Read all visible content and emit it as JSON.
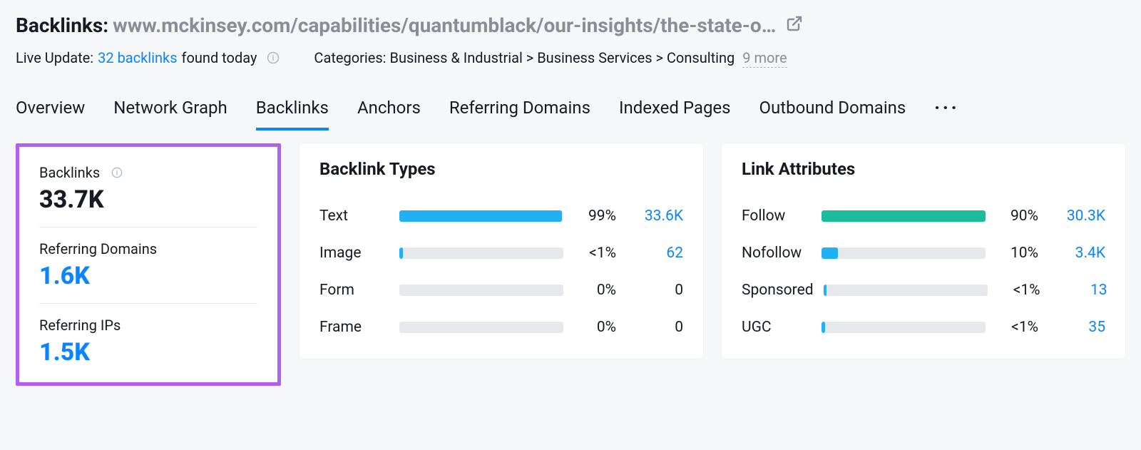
{
  "header": {
    "title_prefix": "Backlinks:",
    "domain_text": "www.mckinsey.com/capabilities/quantumblack/our-insights/the-state-o…"
  },
  "subheader": {
    "live_update_prefix": "Live Update:",
    "backlinks_count_text": "32 backlinks",
    "found_today": "found today",
    "categories_text": "Categories: Business & Industrial > Business Services > Consulting",
    "more_text": "9 more"
  },
  "tabs": {
    "items": [
      {
        "label": "Overview",
        "active": false
      },
      {
        "label": "Network Graph",
        "active": false
      },
      {
        "label": "Backlinks",
        "active": true
      },
      {
        "label": "Anchors",
        "active": false
      },
      {
        "label": "Referring Domains",
        "active": false
      },
      {
        "label": "Indexed Pages",
        "active": false
      },
      {
        "label": "Outbound Domains",
        "active": false
      }
    ]
  },
  "summary": {
    "backlinks_label": "Backlinks",
    "backlinks_value": "33.7K",
    "referring_domains_label": "Referring Domains",
    "referring_domains_value": "1.6K",
    "referring_ips_label": "Referring IPs",
    "referring_ips_value": "1.5K"
  },
  "backlink_types": {
    "title": "Backlink Types",
    "rows": [
      {
        "label": "Text",
        "pct": "99%",
        "count": "33.6K",
        "fill_pct": 99,
        "color": "fill-blue"
      },
      {
        "label": "Image",
        "pct": "<1%",
        "count": "62",
        "fill_pct": 2,
        "color": "fill-blue"
      },
      {
        "label": "Form",
        "pct": "0%",
        "count": "0",
        "fill_pct": 0,
        "color": "fill-blue",
        "zero": true
      },
      {
        "label": "Frame",
        "pct": "0%",
        "count": "0",
        "fill_pct": 0,
        "color": "fill-blue",
        "zero": true
      }
    ]
  },
  "link_attributes": {
    "title": "Link Attributes",
    "rows": [
      {
        "label": "Follow",
        "pct": "90%",
        "count": "30.3K",
        "fill_pct": 100,
        "color": "fill-green"
      },
      {
        "label": "Nofollow",
        "pct": "10%",
        "count": "3.4K",
        "fill_pct": 10,
        "color": "fill-blue"
      },
      {
        "label": "Sponsored",
        "pct": "<1%",
        "count": "13",
        "fill_pct": 2,
        "color": "fill-blue"
      },
      {
        "label": "UGC",
        "pct": "<1%",
        "count": "35",
        "fill_pct": 2,
        "color": "fill-blue"
      }
    ]
  }
}
